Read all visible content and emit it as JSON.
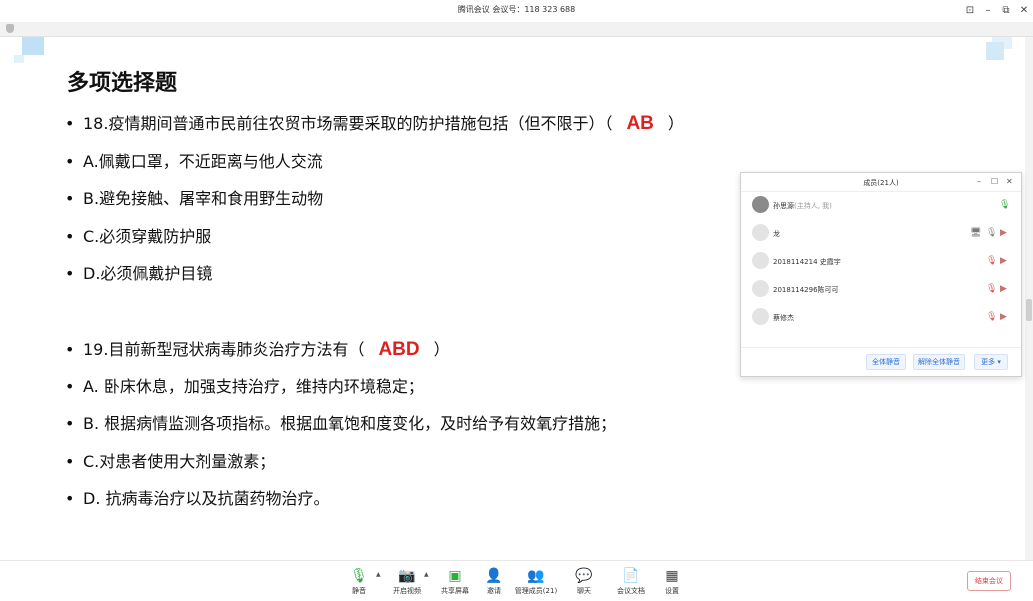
{
  "window": {
    "title": "腾讯会议  会议号：118 323 688"
  },
  "slide": {
    "title": "多项选择题",
    "q18": {
      "text": "18.疫情期间普通市民前往农贸市场需要采取的防护措施包括（但不限于）（",
      "answer": "AB",
      "close": "）"
    },
    "q18_options": [
      "A.佩戴口罩，不近距离与他人交流",
      "B.避免接触、屠宰和食用野生动物",
      "C.必须穿戴防护服",
      "D.必须佩戴护目镜"
    ],
    "q19": {
      "text": "19.目前新型冠状病毒肺炎治疗方法有（",
      "answer": "ABD",
      "close": "）"
    },
    "q19_options": [
      "A. 卧床休息，加强支持治疗，维持内环境稳定；",
      "B. 根据病情监测各项指标。根据血氧饱和度变化，及时给予有效氧疗措施；",
      "C.对患者使用大剂量激素；",
      "D. 抗病毒治疗以及抗菌药物治疗。"
    ],
    "bullet": "•"
  },
  "members_panel": {
    "title": "成员(21人)",
    "members": [
      {
        "name": "孙思源",
        "role": "(主持人, 我)"
      },
      {
        "name": "龙"
      },
      {
        "name": "2018114214    史霞宇"
      },
      {
        "name": "2018114296陈可可"
      },
      {
        "name": "蔡修杰"
      }
    ],
    "buttons": {
      "mute_all": "全体静音",
      "unmute_all": "解除全体静音",
      "more": "更多 ▾"
    }
  },
  "toolbar": {
    "mute": "静音",
    "video": "开启视频",
    "share": "共享屏幕",
    "invite": "邀请",
    "manage": "管理成员(21)",
    "chat": "聊天",
    "docs": "会议文档",
    "settings": "设置",
    "end": "结束会议"
  },
  "colors": {
    "answer": "#e02020",
    "mic_on": "#2fae3a",
    "end": "#e03c3c",
    "link": "#2b6fd6"
  }
}
